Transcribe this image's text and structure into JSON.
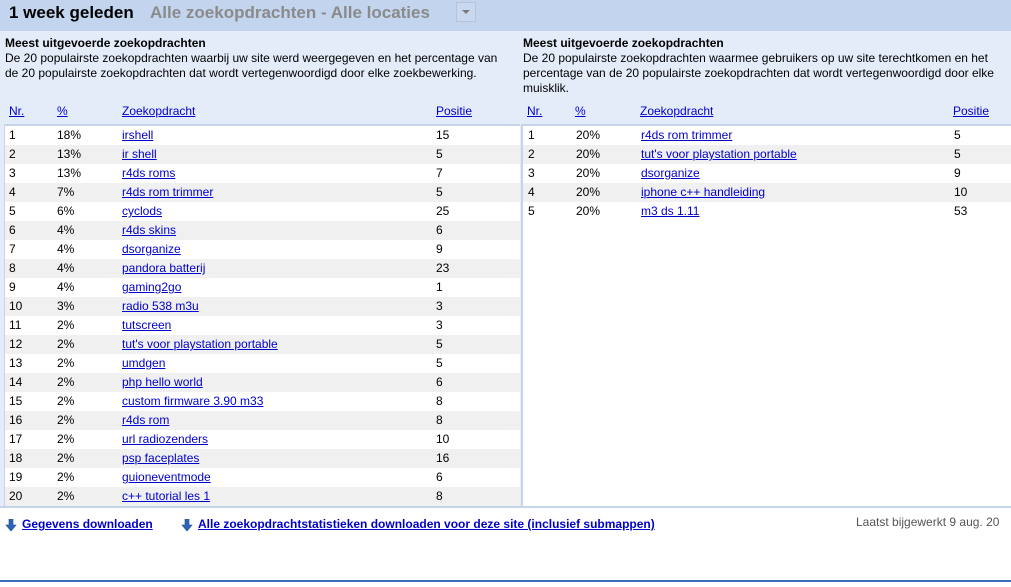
{
  "header": {
    "period": "1 week geleden",
    "filter": "Alle zoekopdrachten - Alle locaties",
    "dropdown_icon": "chevron-down-icon"
  },
  "left_panel": {
    "title": "Meest uitgevoerde zoekopdrachten",
    "description": "De 20 populairste zoekopdrachten waarbij uw site werd weergegeven en het percentage van de 20 populairste zoekopdrachten dat wordt vertegenwoordigd door elke zoekbewerking.",
    "columns": [
      "Nr.",
      "%",
      "Zoekopdracht",
      "Positie"
    ],
    "rows": [
      {
        "nr": "1",
        "pct": "18%",
        "query": "irshell",
        "pos": "15"
      },
      {
        "nr": "2",
        "pct": "13%",
        "query": "ir shell",
        "pos": "5"
      },
      {
        "nr": "3",
        "pct": "13%",
        "query": "r4ds roms",
        "pos": "7"
      },
      {
        "nr": "4",
        "pct": "7%",
        "query": "r4ds rom trimmer",
        "pos": "5"
      },
      {
        "nr": "5",
        "pct": "6%",
        "query": "cyclods",
        "pos": "25"
      },
      {
        "nr": "6",
        "pct": "4%",
        "query": "r4ds skins",
        "pos": "6"
      },
      {
        "nr": "7",
        "pct": "4%",
        "query": "dsorganize",
        "pos": "9"
      },
      {
        "nr": "8",
        "pct": "4%",
        "query": "pandora batterij",
        "pos": "23"
      },
      {
        "nr": "9",
        "pct": "4%",
        "query": "gaming2go",
        "pos": "1"
      },
      {
        "nr": "10",
        "pct": "3%",
        "query": "radio 538 m3u",
        "pos": "3"
      },
      {
        "nr": "11",
        "pct": "2%",
        "query": "tutscreen",
        "pos": "3"
      },
      {
        "nr": "12",
        "pct": "2%",
        "query": "tut's voor playstation portable",
        "pos": "5"
      },
      {
        "nr": "13",
        "pct": "2%",
        "query": "umdgen",
        "pos": "5"
      },
      {
        "nr": "14",
        "pct": "2%",
        "query": "php hello world",
        "pos": "6"
      },
      {
        "nr": "15",
        "pct": "2%",
        "query": "custom firmware 3.90 m33",
        "pos": "8"
      },
      {
        "nr": "16",
        "pct": "2%",
        "query": "r4ds rom",
        "pos": "8"
      },
      {
        "nr": "17",
        "pct": "2%",
        "query": "url radiozenders",
        "pos": "10"
      },
      {
        "nr": "18",
        "pct": "2%",
        "query": "psp faceplates",
        "pos": "16"
      },
      {
        "nr": "19",
        "pct": "2%",
        "query": "guioneventmode",
        "pos": "6"
      },
      {
        "nr": "20",
        "pct": "2%",
        "query": "c++ tutorial les 1",
        "pos": "8"
      }
    ]
  },
  "right_panel": {
    "title": "Meest uitgevoerde zoekopdrachten",
    "description": "De 20 populairste zoekopdrachten waarmee gebruikers op uw site terechtkomen en het percentage van de 20 populairste zoekopdrachten dat wordt vertegenwoordigd door elke muisklik.",
    "columns": [
      "Nr.",
      "%",
      "Zoekopdracht",
      "Positie"
    ],
    "rows": [
      {
        "nr": "1",
        "pct": "20%",
        "query": "r4ds rom trimmer",
        "pos": "5"
      },
      {
        "nr": "2",
        "pct": "20%",
        "query": "tut's voor playstation portable",
        "pos": "5"
      },
      {
        "nr": "3",
        "pct": "20%",
        "query": "dsorganize",
        "pos": "9"
      },
      {
        "nr": "4",
        "pct": "20%",
        "query": "iphone c++ handleiding",
        "pos": "10"
      },
      {
        "nr": "5",
        "pct": "20%",
        "query": "m3 ds 1.11",
        "pos": "53"
      }
    ]
  },
  "footer": {
    "download_data": "Gegevens downloaden",
    "download_all": "Alle zoekopdrachtstatistieken downloaden voor deze site (inclusief submappen)",
    "download_icon": "download-arrow-icon",
    "last_updated": "Laatst bijgewerkt 9 aug. 20"
  }
}
